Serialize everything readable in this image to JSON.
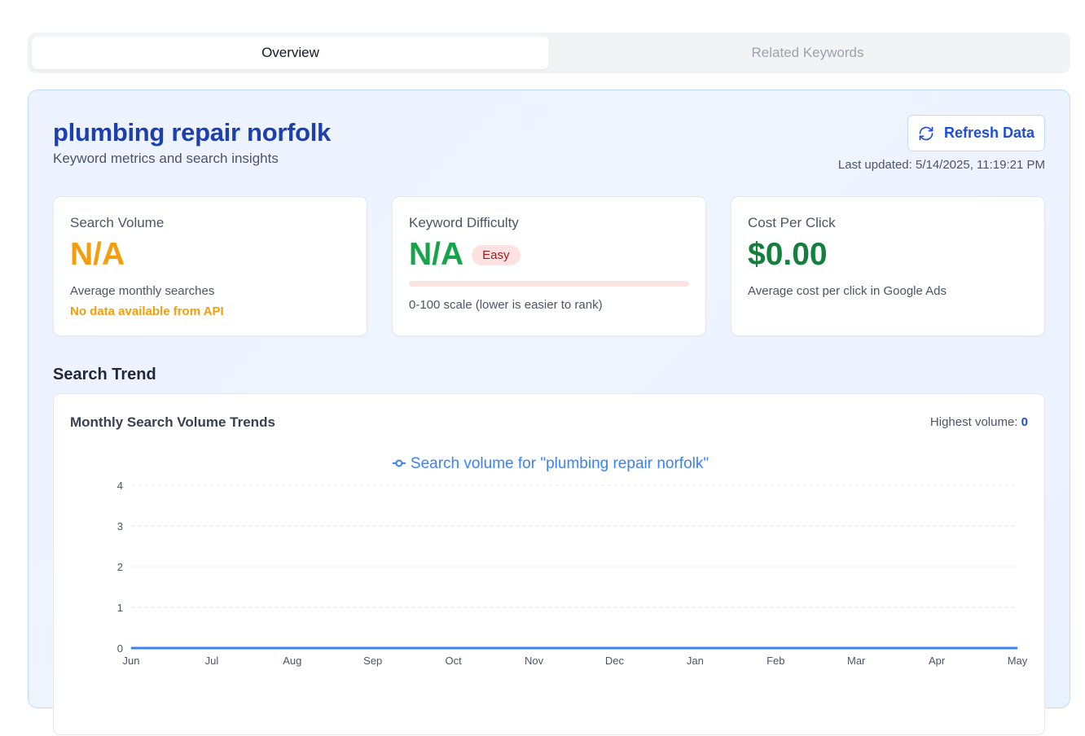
{
  "tabs": [
    {
      "label": "Overview",
      "active": true
    },
    {
      "label": "Related Keywords",
      "active": false
    }
  ],
  "header": {
    "keyword": "plumbing repair norfolk",
    "subtitle": "Keyword metrics and search insights",
    "refresh_label": "Refresh Data",
    "last_updated": "Last updated: 5/14/2025, 11:19:21 PM"
  },
  "cards": {
    "search_volume": {
      "label": "Search Volume",
      "value": "N/A",
      "desc": "Average monthly searches",
      "warning": "No data available from API"
    },
    "keyword_difficulty": {
      "label": "Keyword Difficulty",
      "value": "N/A",
      "badge": "Easy",
      "progress": 0,
      "desc": "0-100 scale (lower is easier to rank)"
    },
    "cpc": {
      "label": "Cost Per Click",
      "value": "$0.00",
      "desc": "Average cost per click in Google Ads"
    }
  },
  "trend": {
    "section_title": "Search Trend",
    "chart_title": "Monthly Search Volume Trends",
    "highest_label": "Highest volume:",
    "highest_value": "0"
  },
  "colors": {
    "accent": "#1d4ed8",
    "line": "#3b82f6",
    "orange": "#f59e0b",
    "green": "#16a34a"
  },
  "chart_data": {
    "type": "line",
    "title": "",
    "legend": "Search volume for \"plumbing repair norfolk\"",
    "x": [
      "Jun",
      "Jul",
      "Aug",
      "Sep",
      "Oct",
      "Nov",
      "Dec",
      "Jan",
      "Feb",
      "Mar",
      "Apr",
      "May"
    ],
    "series": [
      {
        "name": "Search volume for \"plumbing repair norfolk\"",
        "values": [
          0,
          0,
          0,
          0,
          0,
          0,
          0,
          0,
          0,
          0,
          0,
          0
        ]
      }
    ],
    "yticks": [
      "0",
      "1",
      "2",
      "3",
      "4"
    ],
    "ylim": [
      0,
      4
    ],
    "grid": true,
    "legend_position": "top"
  }
}
